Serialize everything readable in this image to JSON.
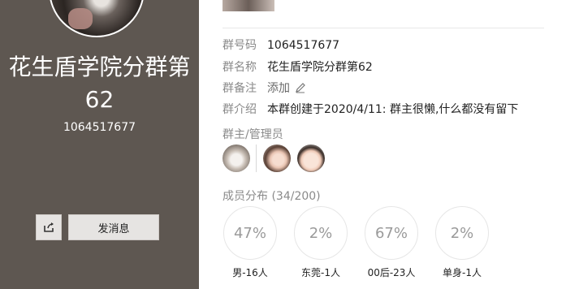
{
  "group": {
    "title": "花生盾学院分群第62",
    "id_display": "1064517677",
    "share_icon": "share-icon",
    "send_message_label": "发消息"
  },
  "info": {
    "number_label": "群号码",
    "number_value": "1064517677",
    "name_label": "群名称",
    "name_value": "花生盾学院分群第62",
    "remark_label": "群备注",
    "remark_add": "添加",
    "remark_icon": "pencil-icon",
    "intro_label": "群介绍",
    "intro_value": "本群创建于2020/4/11:  群主很懒,什么都没有留下"
  },
  "admins": {
    "label": "群主/管理员",
    "avatars": [
      "owner-avatar",
      "admin-avatar-1",
      "admin-avatar-2"
    ]
  },
  "distribution": {
    "label": "成员分布 (34/200)",
    "items": [
      {
        "percent": "47%",
        "label": "男-16人"
      },
      {
        "percent": "2%",
        "label": "东莞-1人"
      },
      {
        "percent": "67%",
        "label": "00后-23人"
      },
      {
        "percent": "2%",
        "label": "单身-1人"
      }
    ]
  },
  "colors": {
    "left_panel": "#5e5751",
    "button_bg": "#e6e4e2",
    "muted_text": "#8a8a8a"
  }
}
